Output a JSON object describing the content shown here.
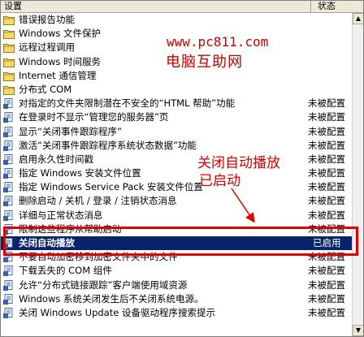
{
  "header": {
    "col_setting": "设置",
    "col_status": "状态"
  },
  "rows": [
    {
      "icon": "folder",
      "name": "错误报告功能",
      "status": ""
    },
    {
      "icon": "folder",
      "name": "Windows 文件保护",
      "status": ""
    },
    {
      "icon": "folder",
      "name": "远程过程调用",
      "status": ""
    },
    {
      "icon": "folder",
      "name": "Windows 时间服务",
      "status": ""
    },
    {
      "icon": "folder",
      "name": "Internet 通信管理",
      "status": ""
    },
    {
      "icon": "folder",
      "name": "分布式 COM",
      "status": ""
    },
    {
      "icon": "policy",
      "name": "对指定的文件夹限制潜在不安全的“HTML 帮助”功能",
      "status": "未被配置"
    },
    {
      "icon": "policy",
      "name": "在登录时不显示“管理您的服务器”页",
      "status": "未被配置"
    },
    {
      "icon": "policy",
      "name": "显示“关闭事件跟踪程序”",
      "status": "未被配置"
    },
    {
      "icon": "policy",
      "name": "激活“关闭事件跟踪程序系统状态数据”功能",
      "status": "未被配置"
    },
    {
      "icon": "policy",
      "name": "启用永久性时间戳",
      "status": "未被配置"
    },
    {
      "icon": "policy",
      "name": "指定 Windows 安装文件位置",
      "status": "未被配置"
    },
    {
      "icon": "policy",
      "name": "指定 Windows Service Pack 安装文件位置",
      "status": "未被配置"
    },
    {
      "icon": "policy",
      "name": "删除启动 / 关机 / 登录 / 注销状态消息",
      "status": "未被配置"
    },
    {
      "icon": "policy",
      "name": "详细与正常状态消息",
      "status": "未被配置"
    },
    {
      "icon": "policy",
      "name": "限制这些程序从帮助启动",
      "status": "未被配置"
    },
    {
      "icon": "policy",
      "name": "关闭自动播放",
      "status": "已启用"
    },
    {
      "icon": "policy",
      "name": "不要自动加密移到加密文件夹中的文件",
      "status": "未被配置"
    },
    {
      "icon": "policy",
      "name": "下载丢失的 COM 组件",
      "status": "未被配置"
    },
    {
      "icon": "policy",
      "name": "允许“分布式链接跟踪”客户端使用域资源",
      "status": "未被配置"
    },
    {
      "icon": "policy",
      "name": "Windows 系统关闭发生后不关闭系统电源。",
      "status": "未被配置"
    },
    {
      "icon": "policy",
      "name": "关闭 Windows Update 设备驱动程序搜索提示",
      "status": "未被配置"
    }
  ],
  "selected_index": 16,
  "watermark": {
    "url": "www.pc811.com",
    "site": "电脑互助网"
  },
  "annotation": {
    "line1": "关闭自动播放",
    "line2": "已启动"
  },
  "colors": {
    "selection": "#0a246a",
    "annotation": "#e00000",
    "folder": "#f5d76e"
  }
}
